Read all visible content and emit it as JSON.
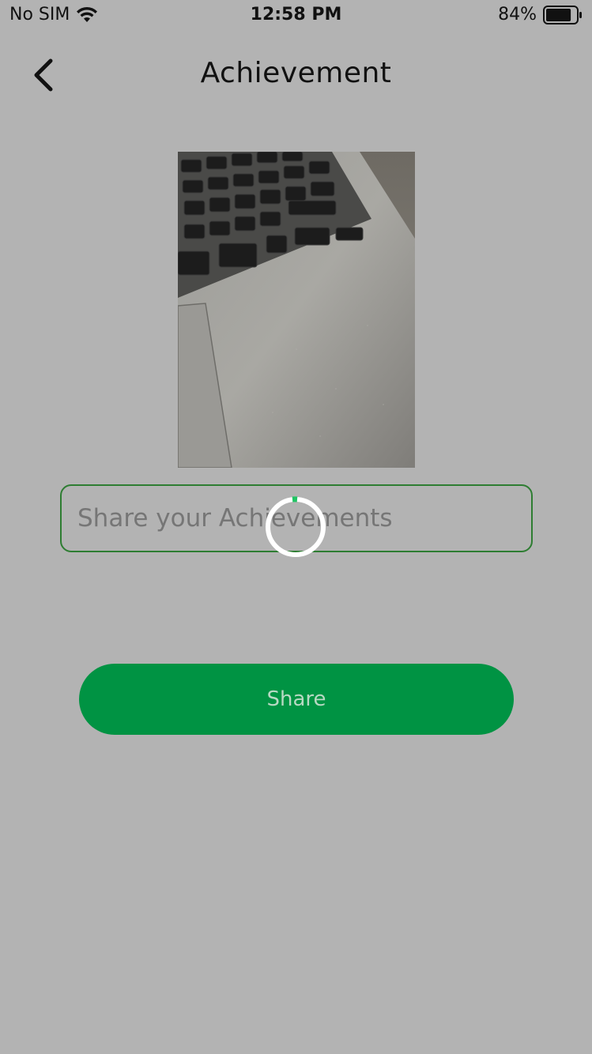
{
  "status_bar": {
    "carrier": "No SIM",
    "time": "12:58 PM",
    "battery_percent": "84%",
    "battery_level": 0.84,
    "wifi_icon": "wifi-icon",
    "battery_icon": "battery-icon"
  },
  "nav": {
    "title": "Achievement",
    "back_icon": "chevron-left-icon"
  },
  "photo": {
    "subject": "laptop keyboard and trackpad photo"
  },
  "input": {
    "value": "",
    "placeholder": "Share your Achievements",
    "border_color": "#2e7d32"
  },
  "spinner": {
    "icon": "loading-spinner-icon",
    "accent_color": "#21c464"
  },
  "share_button": {
    "label": "Share",
    "background_color": "#009343",
    "text_color": "#b7d9c3"
  },
  "colors": {
    "background": "#b3b3b3"
  }
}
